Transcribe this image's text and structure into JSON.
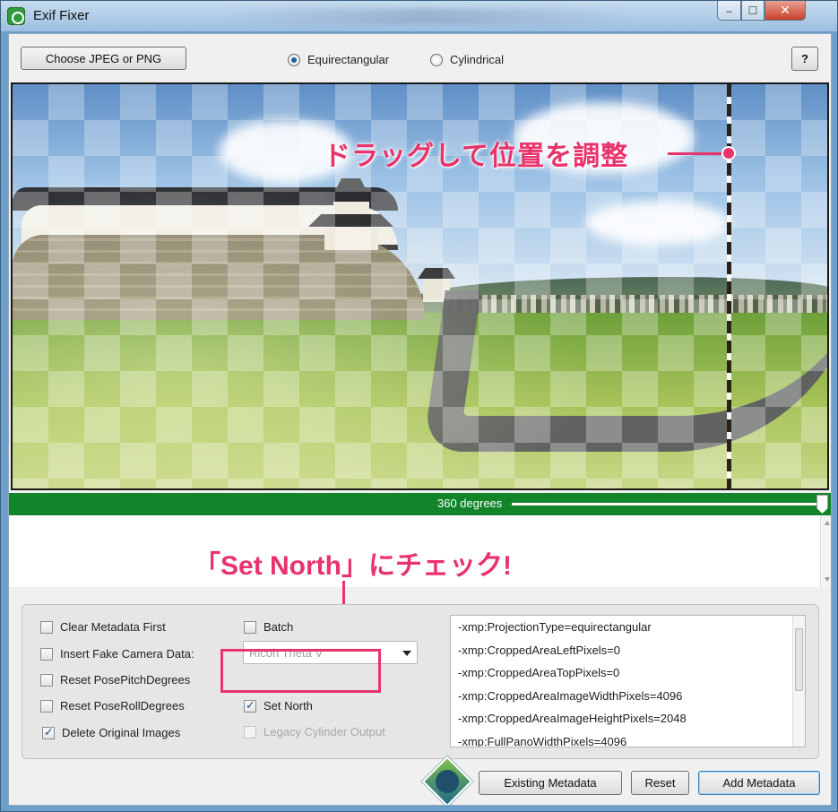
{
  "window": {
    "title": "Exif Fixer"
  },
  "toolbar": {
    "choose_label": "Choose JPEG or PNG",
    "projection_options": [
      "Equirectangular",
      "Cylindrical"
    ],
    "projection_selected": "Equirectangular",
    "help_label": "?"
  },
  "preview": {
    "annotation_drag": "ドラッグして位置を調整",
    "north_handle_color": "#e8336b"
  },
  "degrees": {
    "label": "360 degrees",
    "slider_fraction": 1.0,
    "bar_color": "#12852a"
  },
  "annotation": {
    "check_text": "「Set North」にチェック!",
    "accent_color": "#e8336b"
  },
  "options": {
    "clear_metadata": {
      "label": "Clear Metadata First",
      "checked": false
    },
    "fake_camera": {
      "label": "Insert Fake Camera Data:",
      "checked": false
    },
    "reset_pitch": {
      "label": "Reset PosePitchDegrees",
      "checked": false
    },
    "reset_roll": {
      "label": "Reset PoseRollDegrees",
      "checked": false
    },
    "delete_originals": {
      "label": "Delete Original Images",
      "checked": true
    },
    "batch": {
      "label": "Batch",
      "checked": false
    },
    "camera_select": {
      "value": "Ricoh Theta V"
    },
    "set_north": {
      "label": "Set North",
      "checked": true
    },
    "legacy_cylinder": {
      "label": "Legacy Cylinder Output",
      "checked": false,
      "disabled": true
    }
  },
  "metadata_lines": [
    "-xmp:ProjectionType=equirectangular",
    "-xmp:CroppedAreaLeftPixels=0",
    "-xmp:CroppedAreaTopPixels=0",
    "-xmp:CroppedAreaImageWidthPixels=4096",
    "-xmp:CroppedAreaImageHeightPixels=2048",
    "-xmp:FullPanoWidthPixels=4096"
  ],
  "actions": {
    "existing": "Existing Metadata",
    "reset": "Reset",
    "add": "Add Metadata"
  },
  "icons": {
    "app": "app-icon",
    "minimize": "minimize-icon",
    "maximize": "maximize-icon",
    "close": "close-icon",
    "dropdown": "chevron-down-icon",
    "logo": "logo-icon"
  }
}
